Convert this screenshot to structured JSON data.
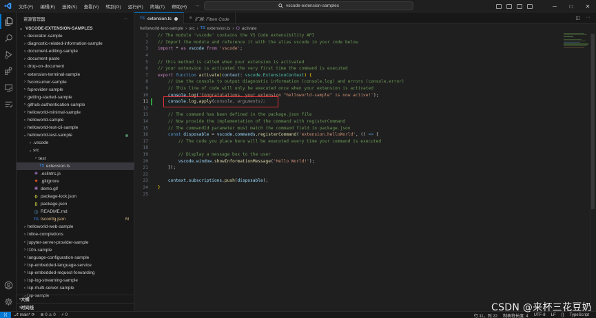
{
  "titlebar": {
    "menus": [
      "文件(F)",
      "编辑(E)",
      "选择(S)",
      "查看(V)",
      "转到(G)",
      "运行(R)",
      "终端(T)",
      "帮助(H)"
    ],
    "search": "vscode-extension-samples",
    "search_icon": "search-icon",
    "minimize": "─",
    "maximize": "□",
    "close": "✕"
  },
  "activity_icons": [
    "explorer-icon",
    "search-icon",
    "run-debug-icon",
    "extensions-icon",
    "remote-explorer-icon",
    "testing-icon",
    "account-icon",
    "settings-gear-icon"
  ],
  "sidebar": {
    "title": "资源管理器",
    "more": "···",
    "section": "VSCODE-EXTENSION-SAMPLES",
    "tree": [
      {
        "label": "decorator-sample",
        "depth": 0,
        "type": "folder-closed"
      },
      {
        "label": "diagnostic-related-information-sample",
        "depth": 0,
        "type": "folder-closed"
      },
      {
        "label": "document-editing-sample",
        "depth": 0,
        "type": "folder-closed"
      },
      {
        "label": "document-paste",
        "depth": 0,
        "type": "folder-closed"
      },
      {
        "label": "drop-on-document",
        "depth": 0,
        "type": "folder-closed"
      },
      {
        "label": "extension-terminal-sample",
        "depth": 0,
        "type": "folder-closed"
      },
      {
        "label": "fsconsumer-sample",
        "depth": 0,
        "type": "folder-closed"
      },
      {
        "label": "fsprovider-sample",
        "depth": 0,
        "type": "folder-closed"
      },
      {
        "label": "getting-started-sample",
        "depth": 0,
        "type": "folder-closed"
      },
      {
        "label": "github-authentication-sample",
        "depth": 0,
        "type": "folder-closed"
      },
      {
        "label": "helloworld-minimal-sample",
        "depth": 0,
        "type": "folder-closed"
      },
      {
        "label": "helloworld-sample",
        "depth": 0,
        "type": "folder-closed"
      },
      {
        "label": "helloworld-test-cli-sample",
        "depth": 0,
        "type": "folder-closed"
      },
      {
        "label": "helloworld-test-sample",
        "depth": 0,
        "type": "folder-open",
        "dot": true
      },
      {
        "label": ".vscode",
        "depth": 1,
        "type": "folder-closed"
      },
      {
        "label": "src",
        "depth": 1,
        "type": "folder-open"
      },
      {
        "label": "test",
        "depth": 2,
        "type": "folder-closed"
      },
      {
        "label": "extension.ts",
        "depth": 2,
        "type": "ts",
        "icon": "TS",
        "selected": true
      },
      {
        "label": ".eslintrc.js",
        "depth": 1,
        "type": "file",
        "icon": "◉",
        "color": "#a074c4"
      },
      {
        "label": ".gitignore",
        "depth": 1,
        "type": "file",
        "icon": "◆",
        "color": "#e44d26"
      },
      {
        "label": "demo.gif",
        "depth": 1,
        "type": "file",
        "icon": "▣",
        "color": "#a074c4"
      },
      {
        "label": "package-lock.json",
        "depth": 1,
        "type": "file",
        "icon": "{}",
        "color": "#cbcb41"
      },
      {
        "label": "package.json",
        "depth": 1,
        "type": "file",
        "icon": "{}",
        "color": "#cbcb41"
      },
      {
        "label": "README.md",
        "depth": 1,
        "type": "file",
        "icon": "ⓘ",
        "color": "#519aba"
      },
      {
        "label": "tsconfig.json",
        "depth": 1,
        "type": "file",
        "icon": "TS",
        "color": "#3178c6",
        "badge": "M",
        "modified": true
      },
      {
        "label": "helloworld-web-sample",
        "depth": 0,
        "type": "folder-closed"
      },
      {
        "label": "inline-completions",
        "depth": 0,
        "type": "folder-closed"
      },
      {
        "label": "jupyter-server-provider-sample",
        "depth": 0,
        "type": "folder-closed"
      },
      {
        "label": "l10n-sample",
        "depth": 0,
        "type": "folder-closed"
      },
      {
        "label": "language-configuration-sample",
        "depth": 0,
        "type": "folder-closed"
      },
      {
        "label": "lsp-embedded-language-service",
        "depth": 0,
        "type": "folder-closed"
      },
      {
        "label": "lsp-embedded-request-forwarding",
        "depth": 0,
        "type": "folder-closed"
      },
      {
        "label": "lsp-log-streaming-sample",
        "depth": 0,
        "type": "folder-closed"
      },
      {
        "label": "lsp-multi-server-sample",
        "depth": 0,
        "type": "folder-closed"
      },
      {
        "label": "lsp-sample",
        "depth": 0,
        "type": "folder-closed"
      }
    ],
    "outline": "大纲",
    "timeline": "时间线"
  },
  "tabs": [
    {
      "icon": "TS",
      "label": "extension.ts",
      "active": true,
      "modified": true
    },
    {
      "icon": "≡",
      "label": "扩展: Fitten Code",
      "active": false
    }
  ],
  "breadcrumb": [
    "helloworld-test-sample",
    "src",
    "extension.ts",
    "activate"
  ],
  "editor": {
    "current_line": 11,
    "lines": [
      [
        [
          "c-cm",
          "// The module 'vscode' contains the VS Code extensibility API"
        ]
      ],
      [
        [
          "c-cm",
          "// Import the module and reference it with the alias vscode in your code below"
        ]
      ],
      [
        [
          "c-ctl",
          "import"
        ],
        [
          "c-p",
          " * "
        ],
        [
          "c-ctl",
          "as"
        ],
        [
          "c-var",
          " vscode "
        ],
        [
          "c-ctl",
          "from"
        ],
        [
          "c-str",
          " 'vscode'"
        ],
        [
          "c-p",
          ";"
        ]
      ],
      [],
      [
        [
          "c-cm",
          "// this method is called when your extension is activated"
        ]
      ],
      [
        [
          "c-cm",
          "// your extension is activated the very first time the command is executed"
        ]
      ],
      [
        [
          "c-ctl",
          "export"
        ],
        [
          "c-kw",
          " function "
        ],
        [
          "c-fn",
          "activate"
        ],
        [
          "c-br",
          "("
        ],
        [
          "c-var",
          "context"
        ],
        [
          "c-p",
          ": "
        ],
        [
          "c-cls",
          "vscode"
        ],
        [
          "c-p",
          "."
        ],
        [
          "c-cls",
          "ExtensionContext"
        ],
        [
          "c-br",
          ")"
        ],
        [
          "c-p",
          " "
        ],
        [
          "c-br",
          "{"
        ]
      ],
      [
        [
          "c-p",
          "    "
        ],
        [
          "c-cm",
          "// Use the console to output diagnostic information (console.log) and errors (console.error)"
        ]
      ],
      [
        [
          "c-p",
          "    "
        ],
        [
          "c-cm",
          "// This line of code will only be executed once when your extension is activated"
        ]
      ],
      [
        [
          "c-p",
          "    "
        ],
        [
          "c-var",
          "console"
        ],
        [
          "c-p",
          "."
        ],
        [
          "c-fn",
          "log"
        ],
        [
          "c-p",
          "("
        ],
        [
          "c-str",
          "'Congratulations, your extension \"helloworld-sample\" is now active!'"
        ],
        [
          "c-p",
          ");"
        ]
      ],
      [
        [
          "c-p",
          "    "
        ],
        [
          "c-var",
          "console"
        ],
        [
          "c-p",
          "."
        ],
        [
          "c-fn",
          "log"
        ],
        [
          "c-p",
          "."
        ],
        [
          "c-fn",
          "apply"
        ],
        [
          "c-p",
          "("
        ],
        [
          "c-ghost",
          "console, arguments);"
        ]
      ],
      [],
      [
        [
          "c-p",
          "    "
        ],
        [
          "c-cm",
          "// The command has been defined in the package.json file"
        ]
      ],
      [
        [
          "c-p",
          "    "
        ],
        [
          "c-cm",
          "// Now provide the implementation of the command with registerCommand"
        ]
      ],
      [
        [
          "c-p",
          "    "
        ],
        [
          "c-cm",
          "// The commandId parameter must match the command field in package.json"
        ]
      ],
      [
        [
          "c-p",
          "    "
        ],
        [
          "c-kw",
          "const "
        ],
        [
          "c-var",
          "disposable"
        ],
        [
          "c-p",
          " = "
        ],
        [
          "c-var",
          "vscode"
        ],
        [
          "c-p",
          "."
        ],
        [
          "c-var",
          "commands"
        ],
        [
          "c-p",
          "."
        ],
        [
          "c-fn",
          "registerCommand"
        ],
        [
          "c-p",
          "("
        ],
        [
          "c-str",
          "'extension.helloWorld'"
        ],
        [
          "c-p",
          ", () "
        ],
        [
          "c-kw",
          "=>"
        ],
        [
          "c-p",
          " {"
        ]
      ],
      [
        [
          "c-p",
          "        "
        ],
        [
          "c-cm",
          "// The code you place here will be executed every time your command is executed"
        ]
      ],
      [],
      [
        [
          "c-p",
          "        "
        ],
        [
          "c-cm",
          "// Display a message box to the user"
        ]
      ],
      [
        [
          "c-p",
          "        "
        ],
        [
          "c-var",
          "vscode"
        ],
        [
          "c-p",
          "."
        ],
        [
          "c-var",
          "window"
        ],
        [
          "c-p",
          "."
        ],
        [
          "c-fn",
          "showInformationMessage"
        ],
        [
          "c-p",
          "("
        ],
        [
          "c-str",
          "'Hello World!'"
        ],
        [
          "c-p",
          ");"
        ]
      ],
      [
        [
          "c-p",
          "    });"
        ]
      ],
      [],
      [
        [
          "c-p",
          "    "
        ],
        [
          "c-var",
          "context"
        ],
        [
          "c-p",
          "."
        ],
        [
          "c-var",
          "subscriptions"
        ],
        [
          "c-p",
          "."
        ],
        [
          "c-fn",
          "push"
        ],
        [
          "c-p",
          "("
        ],
        [
          "c-var",
          "disposable"
        ],
        [
          "c-p",
          ");"
        ]
      ],
      [
        [
          "c-br",
          "}"
        ]
      ],
      []
    ]
  },
  "statusbar": {
    "remote": "⟩⟨",
    "branch": "main*",
    "sync": "⟳",
    "problems": "⊗ 0 ⚠ 0",
    "ports": "⚡ 0",
    "position": "行 11，列 22",
    "indent": "制表符长度: 4",
    "encoding": "UTF-8",
    "eol": "LF",
    "language_braces": "{}",
    "language": "TypeScript"
  },
  "watermark": "CSDN @来杯三花豆奶"
}
